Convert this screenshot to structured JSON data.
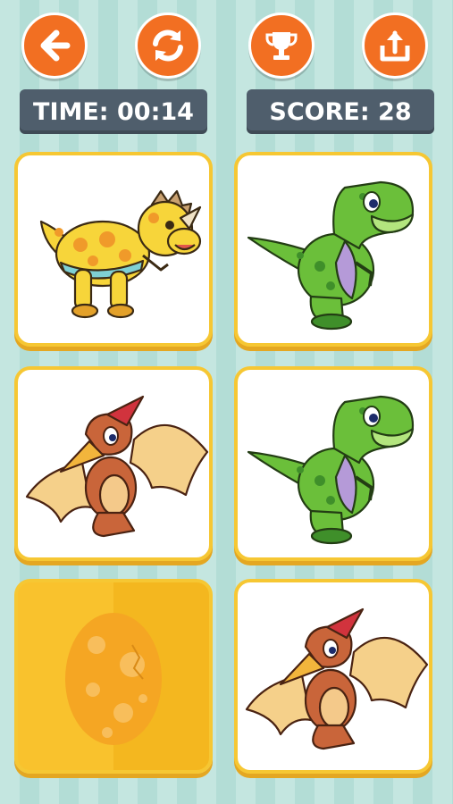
{
  "toolbar": {
    "back_icon": "arrow-left-icon",
    "restart_icon": "refresh-icon",
    "trophy_icon": "trophy-icon",
    "share_icon": "share-upload-icon",
    "accent_color": "#f26f22"
  },
  "hud": {
    "time_text": "TIME: 00:14",
    "score_text": "SCORE: 28"
  },
  "board": {
    "cards": [
      {
        "state": "face-up",
        "creature": "triceratops"
      },
      {
        "state": "face-up",
        "creature": "t-rex"
      },
      {
        "state": "face-up",
        "creature": "pterodactyl"
      },
      {
        "state": "face-up",
        "creature": "t-rex"
      },
      {
        "state": "face-down",
        "creature": "egg-back"
      },
      {
        "state": "face-up",
        "creature": "pterodactyl"
      }
    ]
  }
}
